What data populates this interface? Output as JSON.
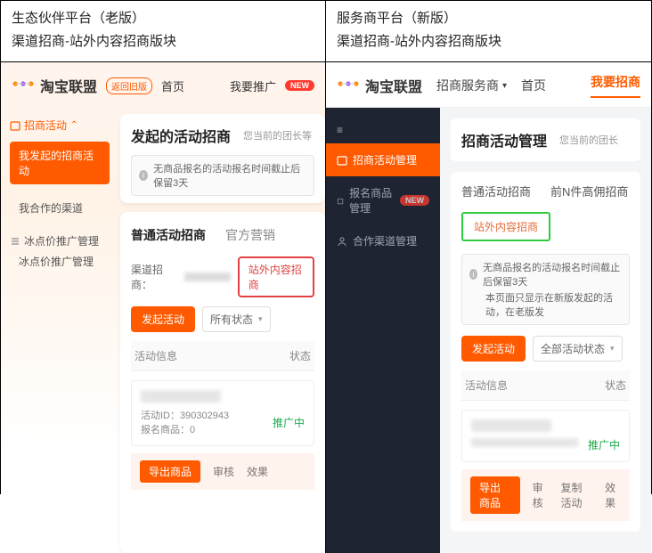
{
  "left": {
    "header": {
      "line1": "生态伙伴平台（老版）",
      "line2": "渠道招商-站外内容招商版块"
    },
    "brand": "淘宝联盟",
    "back_old": "返回旧版",
    "nav_home": "首页",
    "nav_promo": "我要推广",
    "sidebar": {
      "group1": "招商活动",
      "active": "我发起的招商活动",
      "link1": "我合作的渠道",
      "group2": "冰点价推广管理",
      "link2": "冰点价推广管理"
    },
    "panel": {
      "title": "发起的活动招商",
      "subtitle": "您当前的团长等",
      "alert": "无商品报名的活动报名时间截止后保留3天",
      "tab1": "普通活动招商",
      "tab2": "官方营销",
      "filter_label": "渠道招商：",
      "chip": "站外内容招商",
      "btn_create": "发起活动",
      "select_value": "所有状态",
      "col1": "活动信息",
      "col2": "状态",
      "activity_id_label": "活动ID：",
      "activity_id": "390302943",
      "signup_label": "报名商品：",
      "signup_count": "0",
      "status": "推广中",
      "act_export": "导出商品",
      "act_review": "审核",
      "act_effect": "效果"
    }
  },
  "right": {
    "header": {
      "line1": "服务商平台（新版）",
      "line2": "渠道招商-站外内容招商版块"
    },
    "brand": "淘宝联盟",
    "nav_service": "招商服务商",
    "nav_home": "首页",
    "nav_recruit": "我要招商",
    "sidebar": {
      "s1": "招商活动管理",
      "s2": "报名商品管理",
      "s3": "合作渠道管理"
    },
    "panel": {
      "title": "招商活动管理",
      "subtitle": "您当前的团长",
      "tab1": "普通活动招商",
      "tab2": "前N件高佣招商",
      "chip": "站外内容招商",
      "alert1": "无商品报名的活动报名时间截止后保留3天",
      "alert2": "本页面只显示在新版发起的活动，在老版发",
      "btn_create": "发起活动",
      "select_value": "全部活动状态",
      "col1": "活动信息",
      "col2": "状态",
      "status": "推广中",
      "act_export": "导出商品",
      "act_review": "审核",
      "act_copy": "复制活动",
      "act_effect": "效果"
    }
  }
}
